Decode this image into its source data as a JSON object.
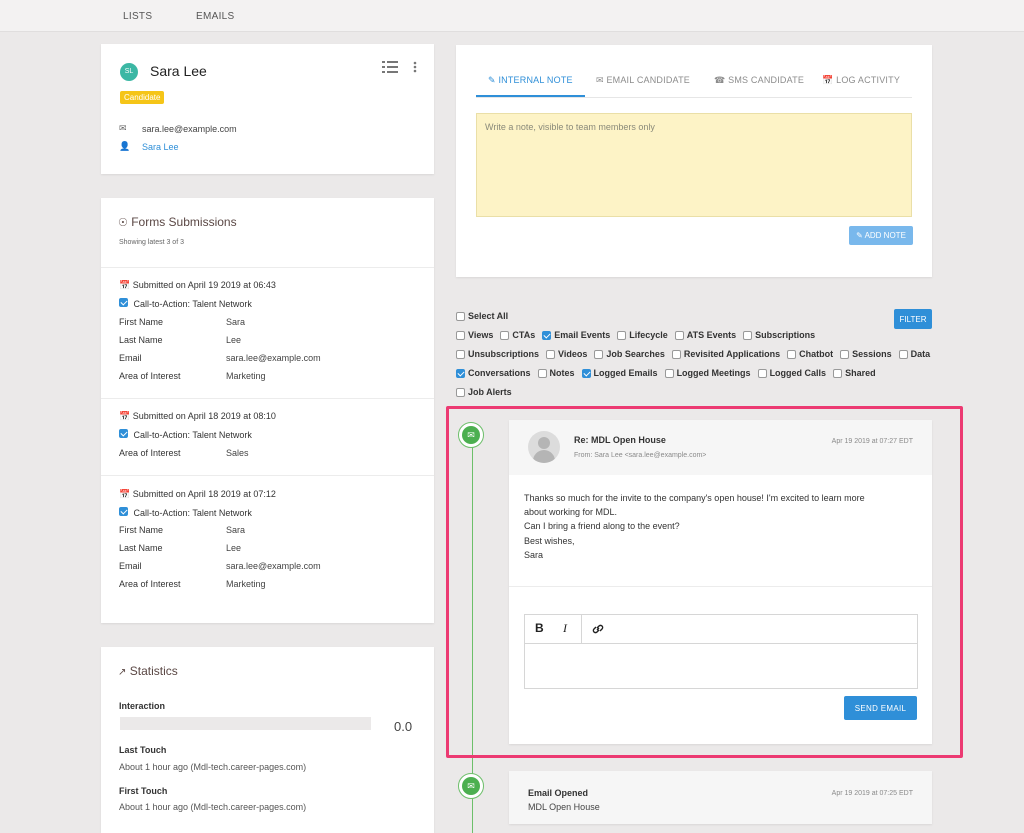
{
  "nav": {
    "lists": "LISTS",
    "emails": "EMAILS"
  },
  "profile": {
    "initials": "SL",
    "name": "Sara Lee",
    "badge": "Candidate",
    "email": "sara.lee@example.com",
    "owner": "Sara Lee"
  },
  "forms": {
    "title": "Forms Submissions",
    "subtitle": "Showing latest 3 of 3",
    "submissions": [
      {
        "submitted": "Submitted on April 19 2019 at 06:43",
        "cta": "Call-to-Action: Talent Network",
        "fields": [
          {
            "k": "First Name",
            "v": "Sara"
          },
          {
            "k": "Last Name",
            "v": "Lee"
          },
          {
            "k": "Email",
            "v": "sara.lee@example.com"
          },
          {
            "k": "Area of Interest",
            "v": "Marketing"
          }
        ]
      },
      {
        "submitted": "Submitted on April 18 2019 at 08:10",
        "cta": "Call-to-Action: Talent Network",
        "fields": [
          {
            "k": "Area of Interest",
            "v": "Sales"
          }
        ]
      },
      {
        "submitted": "Submitted on April 18 2019 at 07:12",
        "cta": "Call-to-Action: Talent Network",
        "fields": [
          {
            "k": "First Name",
            "v": "Sara"
          },
          {
            "k": "Last Name",
            "v": "Lee"
          },
          {
            "k": "Email",
            "v": "sara.lee@example.com"
          },
          {
            "k": "Area of Interest",
            "v": "Marketing"
          }
        ]
      }
    ]
  },
  "stats": {
    "title": "Statistics",
    "interaction_label": "Interaction",
    "interaction_value": "0.0",
    "interaction_fraction": 0,
    "last_touch_label": "Last Touch",
    "last_touch_value": "About 1 hour ago (Mdl-tech.career-pages.com)",
    "first_touch_label": "First Touch",
    "first_touch_value": "About 1 hour ago (Mdl-tech.career-pages.com)"
  },
  "activity": {
    "tabs": [
      "INTERNAL NOTE",
      "EMAIL CANDIDATE",
      "SMS CANDIDATE",
      "LOG ACTIVITY"
    ],
    "note_placeholder": "Write a note, visible to team members only",
    "add_note": "ADD NOTE"
  },
  "filters": {
    "select_all": "Select All",
    "filter_button": "FILTER",
    "items": [
      {
        "label": "Views",
        "checked": false
      },
      {
        "label": "CTAs",
        "checked": false
      },
      {
        "label": "Email Events",
        "checked": true
      },
      {
        "label": "Lifecycle",
        "checked": false
      },
      {
        "label": "ATS Events",
        "checked": false
      },
      {
        "label": "Subscriptions",
        "checked": false
      },
      {
        "label": "Unsubscriptions",
        "checked": false
      },
      {
        "label": "Videos",
        "checked": false
      },
      {
        "label": "Job Searches",
        "checked": false
      },
      {
        "label": "Revisited Applications",
        "checked": false
      },
      {
        "label": "Chatbot",
        "checked": false
      },
      {
        "label": "Sessions",
        "checked": false
      },
      {
        "label": "Data",
        "checked": false
      },
      {
        "label": "Conversations",
        "checked": true
      },
      {
        "label": "Notes",
        "checked": false
      },
      {
        "label": "Logged Emails",
        "checked": true
      },
      {
        "label": "Logged Meetings",
        "checked": false
      },
      {
        "label": "Logged Calls",
        "checked": false
      },
      {
        "label": "Shared",
        "checked": false
      },
      {
        "label": "Job Alerts",
        "checked": false
      }
    ]
  },
  "email": {
    "subject": "Re: MDL Open House",
    "from": "From: Sara Lee <sara.lee@example.com>",
    "date": "Apr 19 2019 at 07:27 EDT",
    "body": [
      "Thanks so much for the invite to the company's open house! I'm excited to learn more",
      "about working for MDL.",
      "Can I bring a friend along to the event?",
      "Best wishes,",
      "Sara"
    ],
    "tool_bold": "B",
    "tool_italic": "I",
    "send": "SEND EMAIL"
  },
  "opened": {
    "title": "Email Opened",
    "subtitle": "MDL Open House",
    "date": "Apr 19 2019 at 07:25 EDT"
  },
  "colors": {
    "accent": "#2f8fd8",
    "timeline": "#4caf50",
    "highlight": "#ec3a72",
    "badge": "#f5c518"
  }
}
